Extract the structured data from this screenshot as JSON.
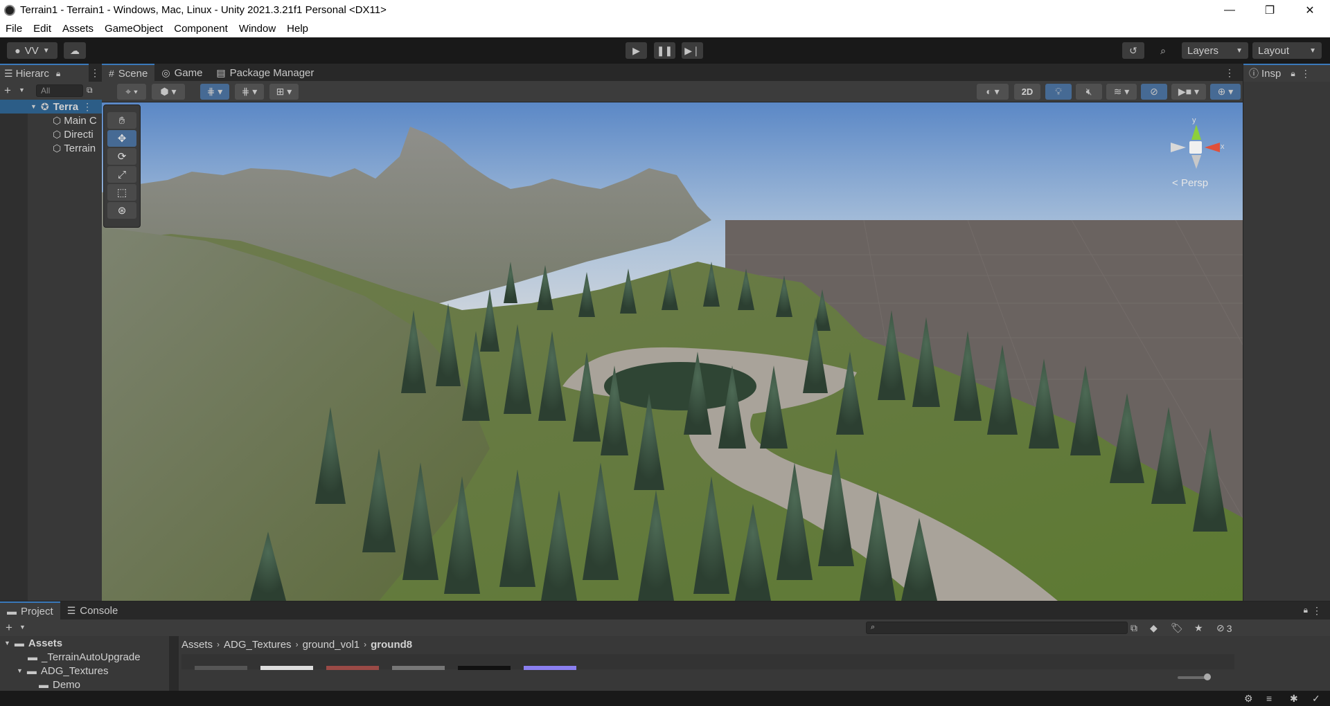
{
  "window": {
    "title": "Terrain1 - Terrain1 - Windows, Mac, Linux - Unity 2021.3.21f1 Personal <DX11>",
    "minimize": "—",
    "maximize": "❐",
    "close": "✕"
  },
  "menu": [
    "File",
    "Edit",
    "Assets",
    "GameObject",
    "Component",
    "Window",
    "Help"
  ],
  "toolbar": {
    "account": "VV",
    "layers": "Layers",
    "layout": "Layout"
  },
  "hierarchy": {
    "tab_label": "Hierarc",
    "search_placeholder": "All",
    "scene_name": "Terra",
    "items": [
      "Main C",
      "Directi",
      "Terrain"
    ]
  },
  "scene_tabs": [
    "Scene",
    "Game",
    "Package Manager"
  ],
  "scene_toolbar": {
    "mode_2d": "2D"
  },
  "gizmo": {
    "y_label": "y",
    "x_label": "x",
    "projection": "Persp"
  },
  "inspector": {
    "tab_label": "Insp"
  },
  "project": {
    "tabs": [
      "Project",
      "Console"
    ],
    "tree": [
      "Assets",
      "_TerrainAutoUpgrade",
      "ADG_Textures",
      "Demo"
    ],
    "breadcrumb": [
      "Assets",
      "ADG_Textures",
      "ground_vol1",
      "ground8"
    ],
    "hidden_count": "3"
  },
  "colors": {
    "accent": "#3a79bb",
    "selected_tool": "#466a94",
    "panel": "#383838"
  }
}
